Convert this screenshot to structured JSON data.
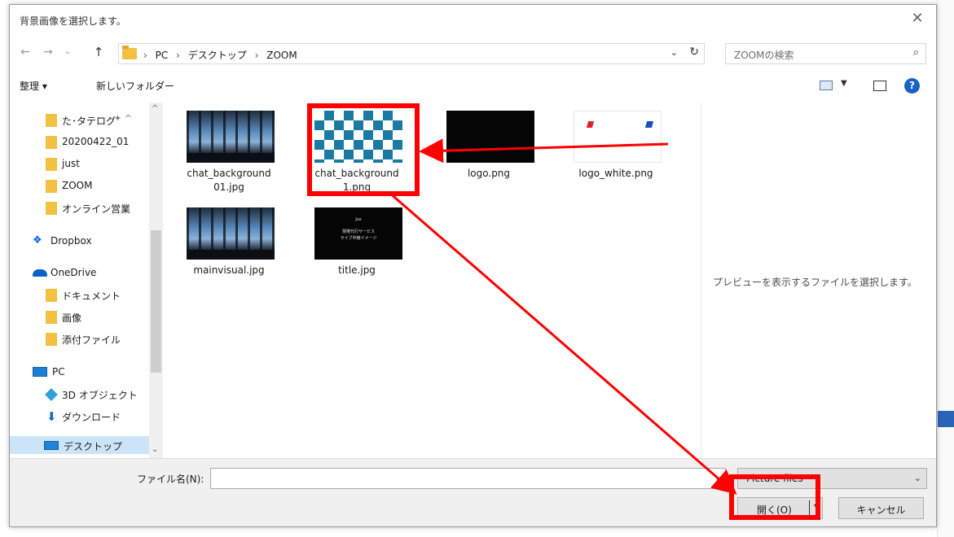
{
  "dialog": {
    "title": "背景画像を選択します。",
    "close_glyph": "✕"
  },
  "address": {
    "crumbs": [
      "PC",
      "デスクトップ",
      "ZOOM"
    ],
    "separator": "›",
    "search_placeholder": "ZOOMの検索"
  },
  "toolbar": {
    "organize": "整理 ▾",
    "new_folder": "新しいフォルダー",
    "help": "?"
  },
  "nav": {
    "items": [
      {
        "label": "た･タテログ",
        "icon": "folder-icon",
        "pinned": true
      },
      {
        "label": "20200422_01",
        "icon": "folder-icon"
      },
      {
        "label": "just",
        "icon": "folder-icon"
      },
      {
        "label": "ZOOM",
        "icon": "folder-icon"
      },
      {
        "label": "オンライン営業",
        "icon": "folder-icon"
      },
      {
        "label": "Dropbox",
        "icon": "dropbox-icon"
      },
      {
        "label": "OneDrive",
        "icon": "onedrive-icon"
      },
      {
        "label": "ドキュメント",
        "icon": "folder-icon"
      },
      {
        "label": "画像",
        "icon": "folder-icon"
      },
      {
        "label": "添付ファイル",
        "icon": "folder-icon"
      },
      {
        "label": "PC",
        "icon": "pc-icon"
      },
      {
        "label": "3D オブジェクト",
        "icon": "3d-objects-icon"
      },
      {
        "label": "ダウンロード",
        "icon": "download-icon"
      },
      {
        "label": "デスクトップ",
        "icon": "desktop-icon",
        "selected": true
      }
    ]
  },
  "files": [
    {
      "name": "chat_background 01.jpg",
      "name_lines": [
        "chat_background",
        "01.jpg"
      ],
      "thumb": "photo"
    },
    {
      "name": "chat_background 1.png",
      "name_lines": [
        "chat_background",
        "1.png"
      ],
      "thumb": "checker"
    },
    {
      "name": "logo.png",
      "name_lines": [
        "logo.png"
      ],
      "thumb": "black"
    },
    {
      "name": "logo_white.png",
      "name_lines": [
        "logo_white.png"
      ],
      "thumb": "white"
    },
    {
      "name": "mainvisual.jpg",
      "name_lines": [
        "mainvisual.jpg"
      ],
      "thumb": "photo"
    },
    {
      "name": "title.jpg",
      "name_lines": [
        "title.jpg"
      ],
      "thumb": "title",
      "thumb_text": [
        "Jus",
        "現場代行サービス",
        "ライブ中継イメージ"
      ]
    }
  ],
  "preview": {
    "message": "プレビューを表示するファイルを選択します。"
  },
  "bottom": {
    "filename_label": "ファイル名(N):",
    "filename_value": "",
    "filetype": "Picture files",
    "open": "開く(O)",
    "cancel": "キャンセル"
  },
  "colors": {
    "annotation": "#ff0000",
    "selection": "#cce4f7",
    "accent": "#1a63c6"
  }
}
